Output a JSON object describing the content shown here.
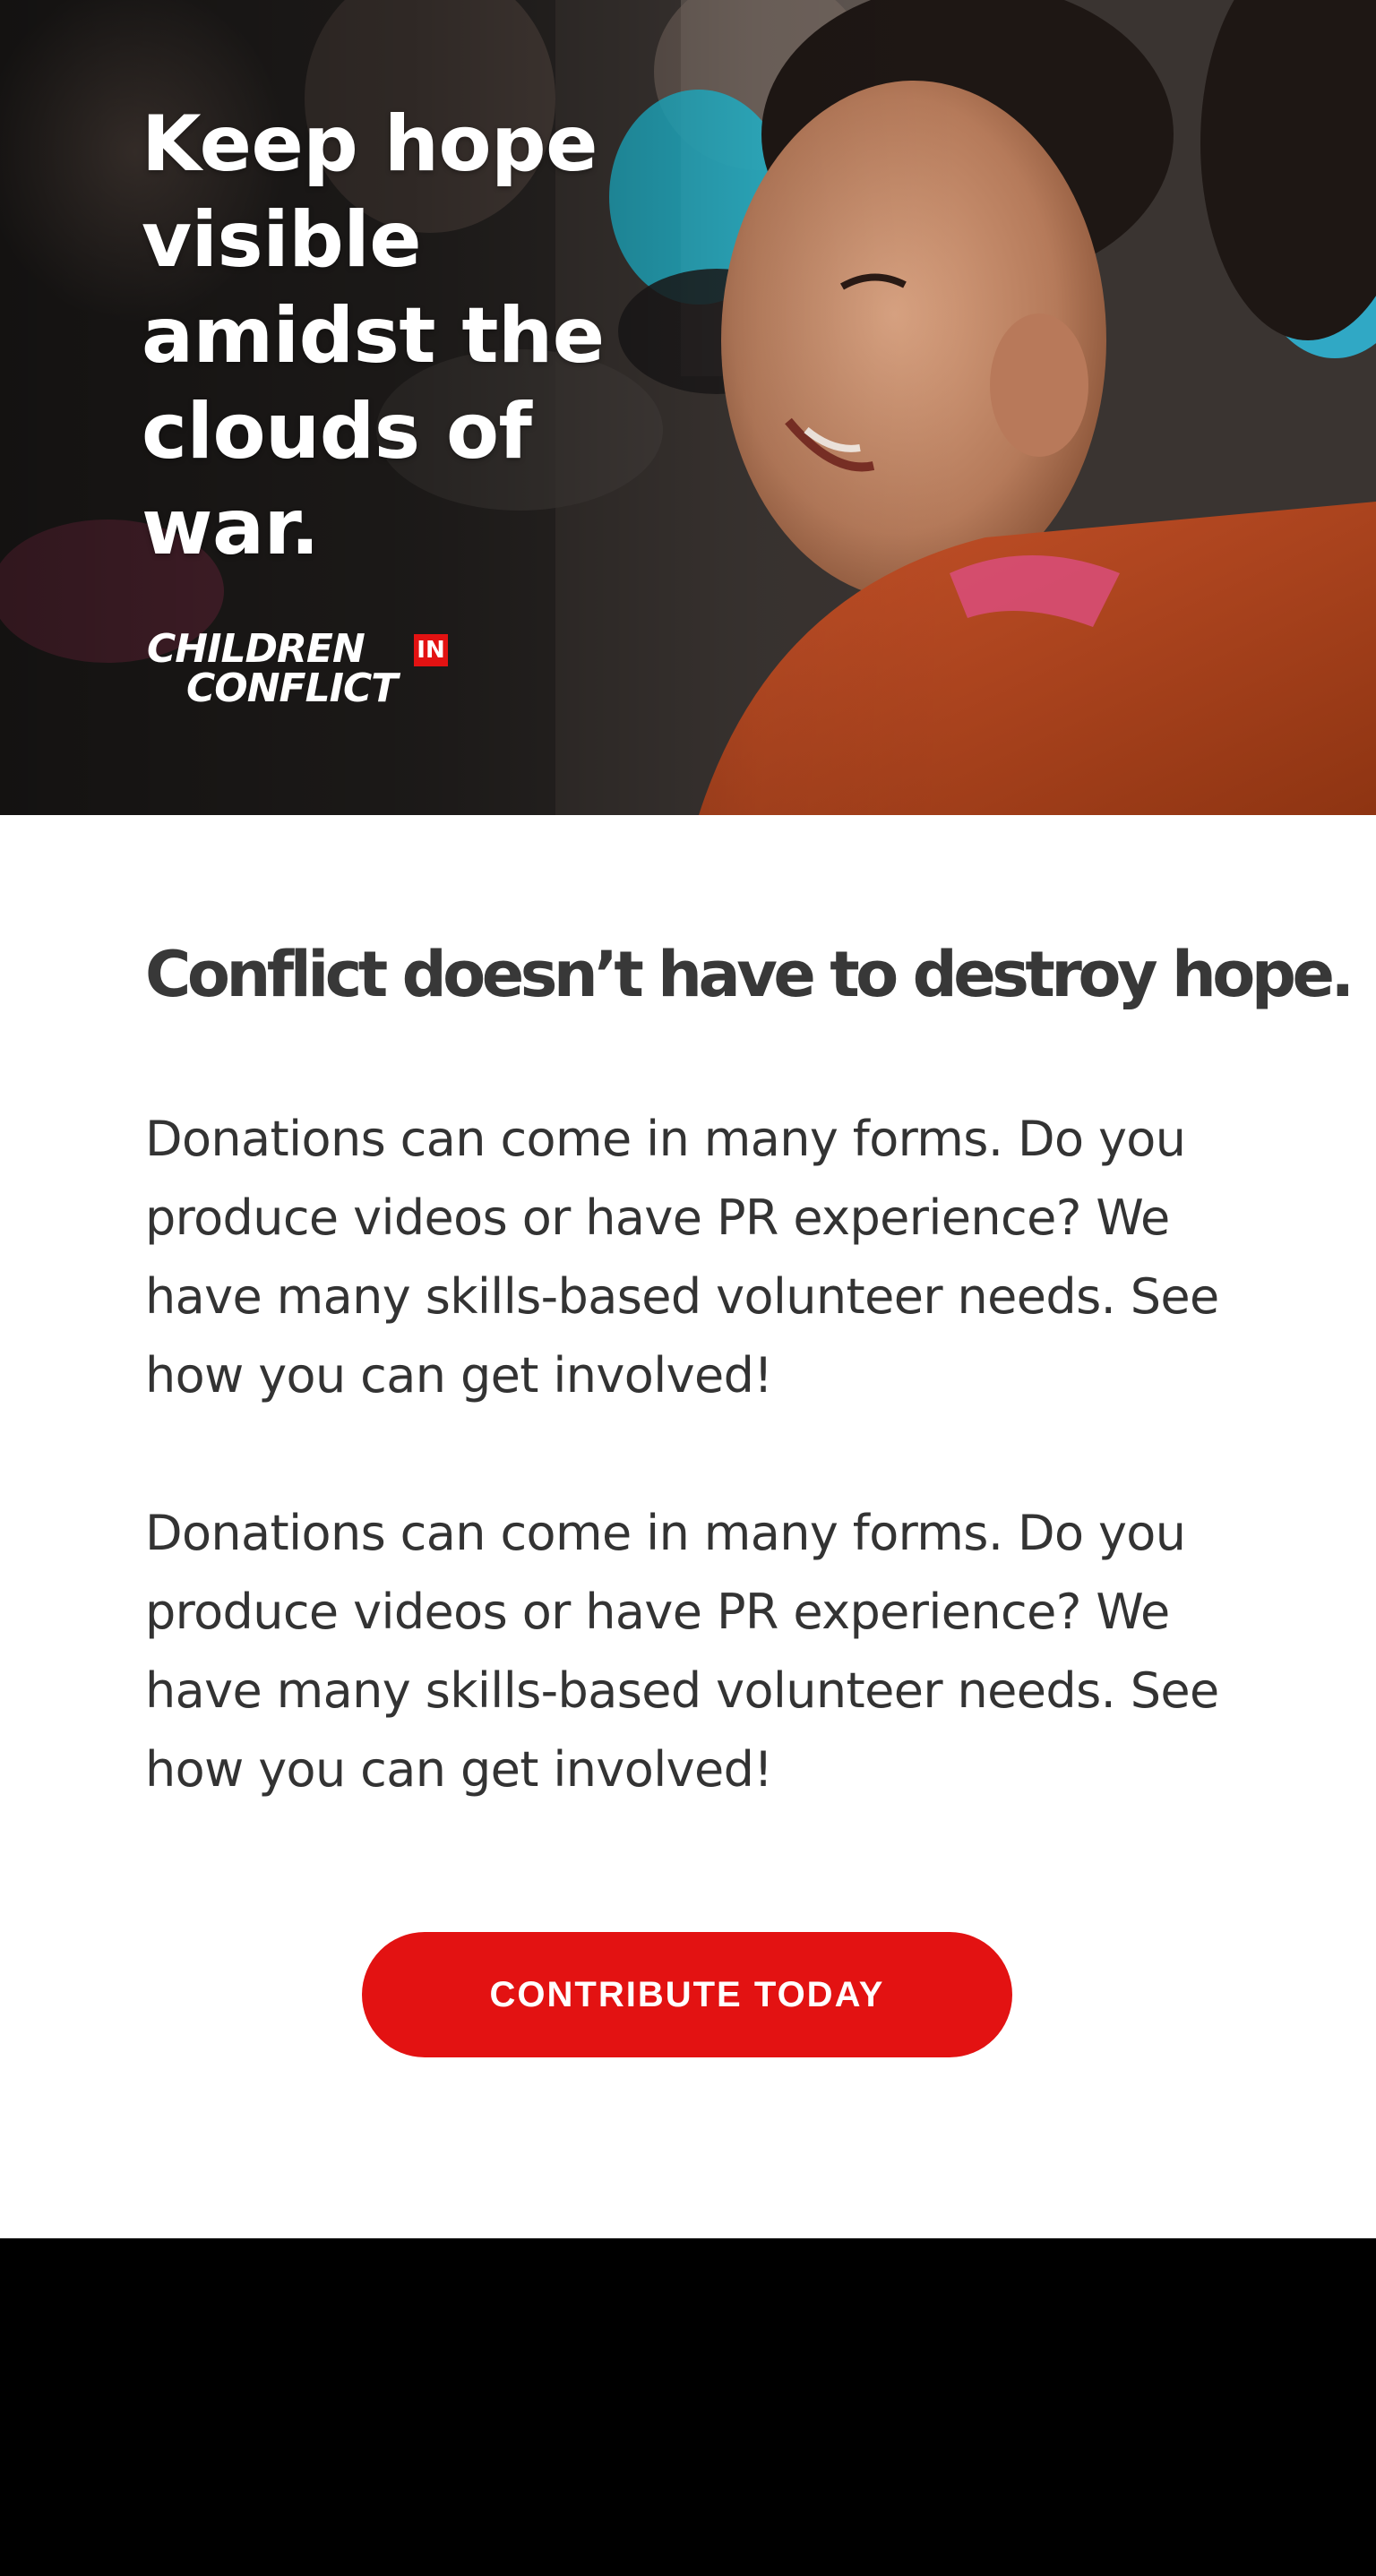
{
  "hero": {
    "title": "Keep hope visible amidst the clouds of war.",
    "logo": {
      "line1": "CHILDREN",
      "badge": "IN",
      "line2": "CONFLICT",
      "accent_color": "#e31212"
    }
  },
  "content": {
    "headline": "Conflict doesn’t have to destroy hope.",
    "paragraphs": [
      "Donations can come in many forms. Do you produce videos or have PR experience? We have many skills-based volunteer needs. See how you can get involved!",
      "Donations can come in many forms. Do you produce videos or have PR experience? We have many skills-based volunteer needs. See how you can get involved!"
    ],
    "cta_label": "CONTRIBUTE TODAY",
    "cta_color": "#e31212"
  },
  "colors": {
    "text_dark": "#383838",
    "background": "#ffffff",
    "footer": "#000000"
  }
}
